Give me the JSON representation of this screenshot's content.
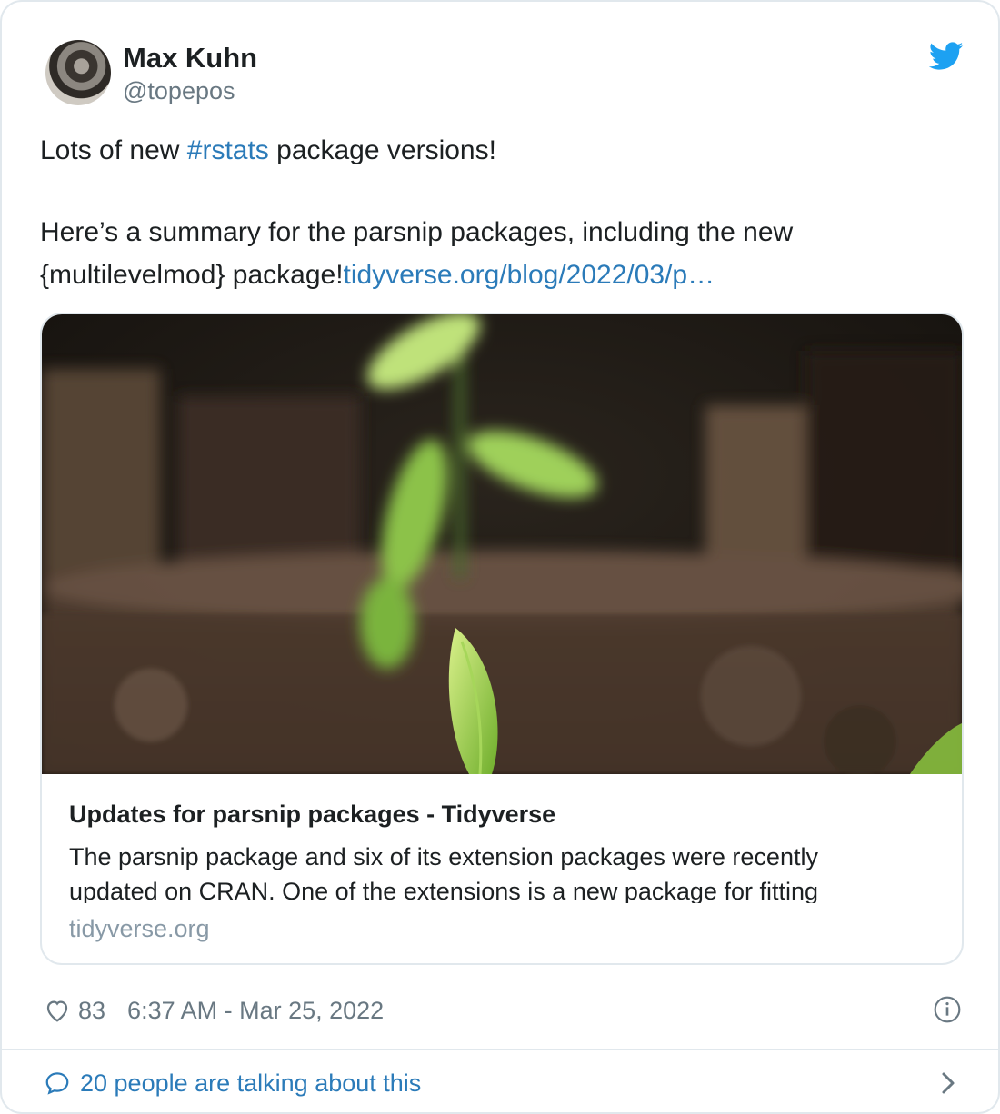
{
  "author": {
    "name": "Max Kuhn",
    "handle": "@topepos"
  },
  "tweet": {
    "line1_before": "Lots of new ",
    "hashtag": "#rstats",
    "line1_after": " package versions!",
    "line2": "Here’s a summary for the parsnip packages, including the new",
    "line3_before": "{multilevelmod} package!",
    "link": "tidyverse.org/blog/2022/03/p…"
  },
  "card": {
    "title": "Updates for parsnip packages - Tidyverse",
    "description": "The parsnip package and six of its extension packages were recently updated on CRAN. One of the extensions is a new package for fitting",
    "domain": "tidyverse.org"
  },
  "stats": {
    "likes": "83",
    "timestamp": "6:37 AM - Mar 25, 2022"
  },
  "footer": {
    "talking": "20 people are talking about this"
  },
  "icons": {
    "logo": "twitter-bird-icon",
    "like": "heart-icon",
    "info": "info-icon",
    "reply": "speech-bubble-icon",
    "more": "chevron-right-icon"
  },
  "colors": {
    "link": "#2b7bb9",
    "twitter_blue": "#1da1f2",
    "muted": "#697882",
    "border": "#e1e8ed"
  }
}
